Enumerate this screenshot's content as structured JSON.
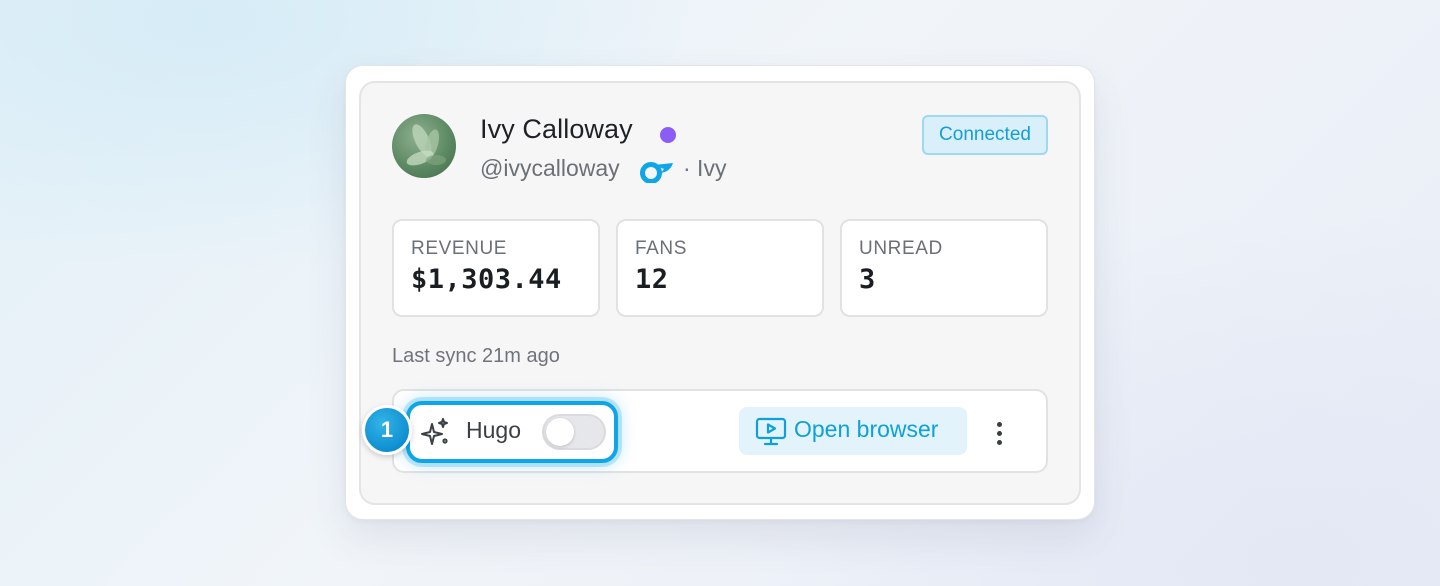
{
  "profile": {
    "name": "Ivy Calloway",
    "handle": "@ivycalloway",
    "alias": "· Ivy",
    "status_color": "#8b5cf6",
    "platform_icon": "platform-logo-icon",
    "connection_status": "Connected"
  },
  "stats": [
    {
      "label": "REVENUE",
      "value": "$1,303.44"
    },
    {
      "label": "FANS",
      "value": "12"
    },
    {
      "label": "UNREAD",
      "value": "3"
    }
  ],
  "last_sync": "Last sync 21m ago",
  "actions": {
    "assistant_label": "Hugo",
    "assistant_icon": "sparkle-icon",
    "assistant_enabled": false,
    "step_number": "1",
    "open_browser_label": "Open browser",
    "open_browser_icon": "monitor-play-icon",
    "more_icon": "more-vertical-icon"
  },
  "colors": {
    "accent": "#0ea5e9",
    "badge_text": "#169ed4",
    "badge_bg": "#d9f0fa"
  }
}
